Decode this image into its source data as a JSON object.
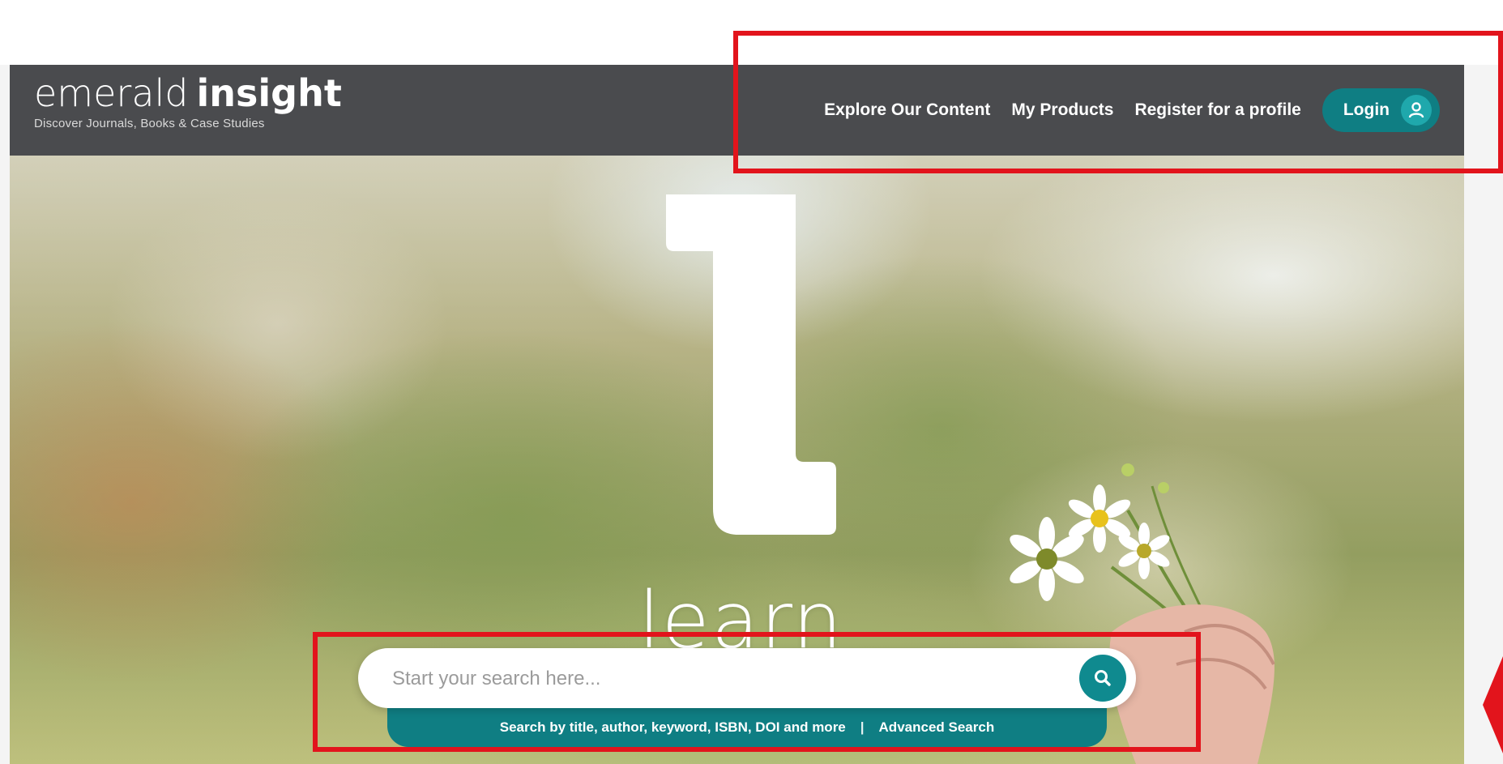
{
  "header": {
    "logo_light": "emerald",
    "logo_bold": "insight",
    "tagline": "Discover Journals, Books & Case Studies",
    "nav_items": [
      "Explore Our Content",
      "My Products",
      "Register for a profile"
    ],
    "login_label": "Login"
  },
  "hero": {
    "letter": "l",
    "word": "learn"
  },
  "search": {
    "placeholder": "Start your search here...",
    "hint": "Search by title, author, keyword, ISBN, DOI and more",
    "separator": "|",
    "advanced_label": "Advanced Search"
  },
  "colors": {
    "navbar": "#4a4b4e",
    "accent": "#0f7e83",
    "highlight": "#e2141c"
  }
}
